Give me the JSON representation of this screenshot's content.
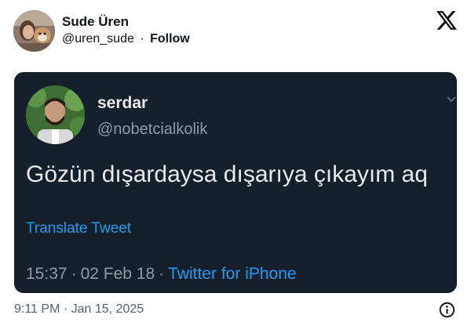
{
  "author": {
    "name": "Sude Üren",
    "handle": "@uren_sude",
    "separator": "·",
    "follow_label": "Follow"
  },
  "icons": {
    "brand": "x-logo-icon",
    "info": "info-icon",
    "more": "chevron-down-icon"
  },
  "embedded": {
    "name": "serdar",
    "handle": "@nobetcialkolik",
    "text": "Gözün dışardaysa dışarıya çıkayım aq",
    "translate_label": "Translate Tweet",
    "time": "15:37",
    "date": "02 Feb 18",
    "separator": "·",
    "source": "Twitter for iPhone"
  },
  "timestamp": "9:11 PM · Jan 15, 2025",
  "colors": {
    "embed_background": "#15202b",
    "link_blue": "#1d9bf0",
    "secondary_text": "#8b98a5"
  }
}
